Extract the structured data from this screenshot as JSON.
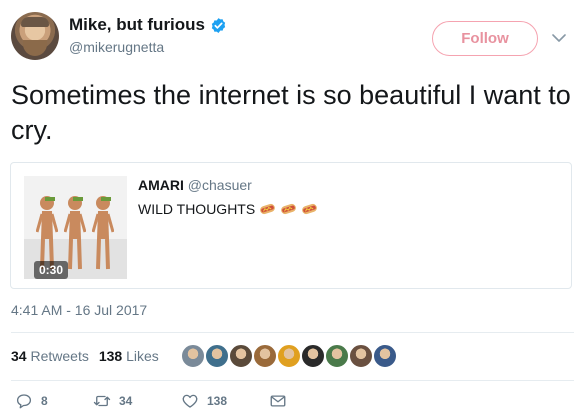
{
  "author": {
    "name": "Mike, but furious",
    "handle": "@mikerugnetta"
  },
  "follow_label": "Follow",
  "tweet_text": "Sometimes the internet is so beautiful I want to cry.",
  "quoted": {
    "name": "AMARI",
    "handle": "@chasuer",
    "text": "WILD THOUGHTS",
    "emoji": [
      "hot-dog-emoji",
      "hot-dog-emoji",
      "hot-dog-emoji"
    ],
    "video_duration": "0:30"
  },
  "timestamp": "4:41 AM - 16 Jul 2017",
  "stats": {
    "retweets_count": "34",
    "retweets_label": "Retweets",
    "likes_count": "138",
    "likes_label": "Likes"
  },
  "liker_avatar_colors": [
    "#7a8a99",
    "#3f6f8c",
    "#5a4a3a",
    "#9a6a3a",
    "#e0a020",
    "#2a2a2a",
    "#4a7a4a",
    "#6a5040",
    "#3a5a8a"
  ],
  "actions": {
    "replies": "8",
    "retweets": "34",
    "likes": "138"
  },
  "colors": {
    "verified": "#1da1f2",
    "follow_border": "#f5a3b0",
    "follow_text": "#e8929f",
    "secondary_text": "#657786"
  }
}
